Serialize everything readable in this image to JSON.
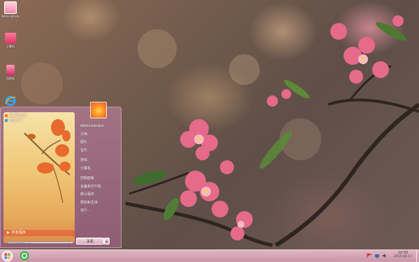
{
  "desktop": {
    "icons": [
      {
        "label": "Administrato...",
        "icon": "user-folder-icon"
      },
      {
        "label": "计算机",
        "icon": "computer-icon"
      },
      {
        "label": "回收站",
        "icon": "recycle-bin-icon"
      },
      {
        "label": "",
        "icon": "internet-explorer-icon"
      }
    ]
  },
  "start_menu": {
    "pinned": [
      {
        "label": "好桌面主题",
        "icon": "theme-app-icon"
      },
      {
        "label": "酷云小工",
        "icon": "tool-app-icon"
      }
    ],
    "all_programs": "所有程序",
    "search_placeholder": "搜索程序和文件",
    "user_name": "Administrator",
    "right_items": [
      "文档",
      "图片",
      "音乐",
      "游戏",
      "计算机",
      "控制面板",
      "设备和打印机",
      "默认程序",
      "帮助和支持",
      "运行..."
    ],
    "shutdown_label": "关机"
  },
  "taskbar": {
    "clock_time": "10:50",
    "clock_date": "2015-04-17"
  },
  "colors": {
    "accent_orange": "#e36f3e",
    "taskbar_pink": "#e9bccb"
  }
}
